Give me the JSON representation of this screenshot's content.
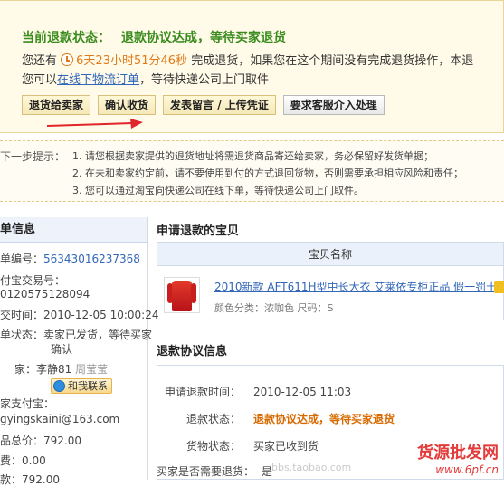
{
  "status": {
    "label": "当前退款状态：",
    "value": "退款协议达成，等待买家退货",
    "line1_before": "您还有",
    "countdown": "6天23小时51分46秒",
    "line1_after": "完成退货，如果您在这个期间没有完成退货操作，本退",
    "line2_before": "您可以",
    "line2_link": "在线下物流订单",
    "line2_after": "，等待快递公司上门取件"
  },
  "buttons": {
    "return_to_seller": "退货给卖家",
    "confirm_receipt": "确认收货",
    "leave_message": "发表留言 / 上传凭证",
    "request_service": "要求客服介入处理"
  },
  "tips": {
    "label": "下一步提示：",
    "items": [
      "1.  请您根据卖家提供的退货地址将需退货商品寄还给卖家，务必保留好发货单据；",
      "2.  在未和卖家约定前，请不要使用到付的方式退回货物，否则需要承担相应风险和责任；",
      "3.  您可以通过淘宝向快递公司在线下单，等待快递公司上门取件。"
    ]
  },
  "order": {
    "title": "单信息",
    "order_no_label": "单编号：",
    "order_no": "56343016237368",
    "alipay_no_label": "付宝交易号：",
    "alipay_no": "0120575128094",
    "time_label": "交时间：",
    "time": "2010-12-05 10:00:24",
    "state_label": "单状态：",
    "state": "卖家已发货，等待买家",
    "state2": "确认",
    "seller_label": "家：",
    "seller": "李静81",
    "seller_extra": "周莹莹",
    "contact": "和我联系",
    "seller_alipay_label": "家支付宝：",
    "seller_alipay": "gyingskaini@163.com",
    "total_label": "品总价：",
    "total": "792.00",
    "fee_label": "费：",
    "fee": "0.00",
    "paid_label": "款：",
    "paid": "792.00"
  },
  "item": {
    "section_title": "申请退款的宝贝",
    "header": "宝贝名称",
    "name": "2010新款 AFT611H型中长大衣 艾莱依专柜正品 假一罚十",
    "prop": "颜色分类：浓咖色   尺码：S"
  },
  "agreement": {
    "section_title": "退款协议信息",
    "apply_time_label": "申请退款时间：",
    "apply_time": "2010-12-05 11:03",
    "status_label": "退款状态：",
    "status": "退款协议达成，等待买家退货",
    "goods_label": "货物状态：",
    "goods": "买家已收到货",
    "need_return_label": "买家是否需要退货：",
    "need_return": "是"
  },
  "watermark": {
    "site_cn": "货源批发网",
    "site_url": "www.6pf.cn",
    "bbs": "bbs.taobao.com"
  }
}
